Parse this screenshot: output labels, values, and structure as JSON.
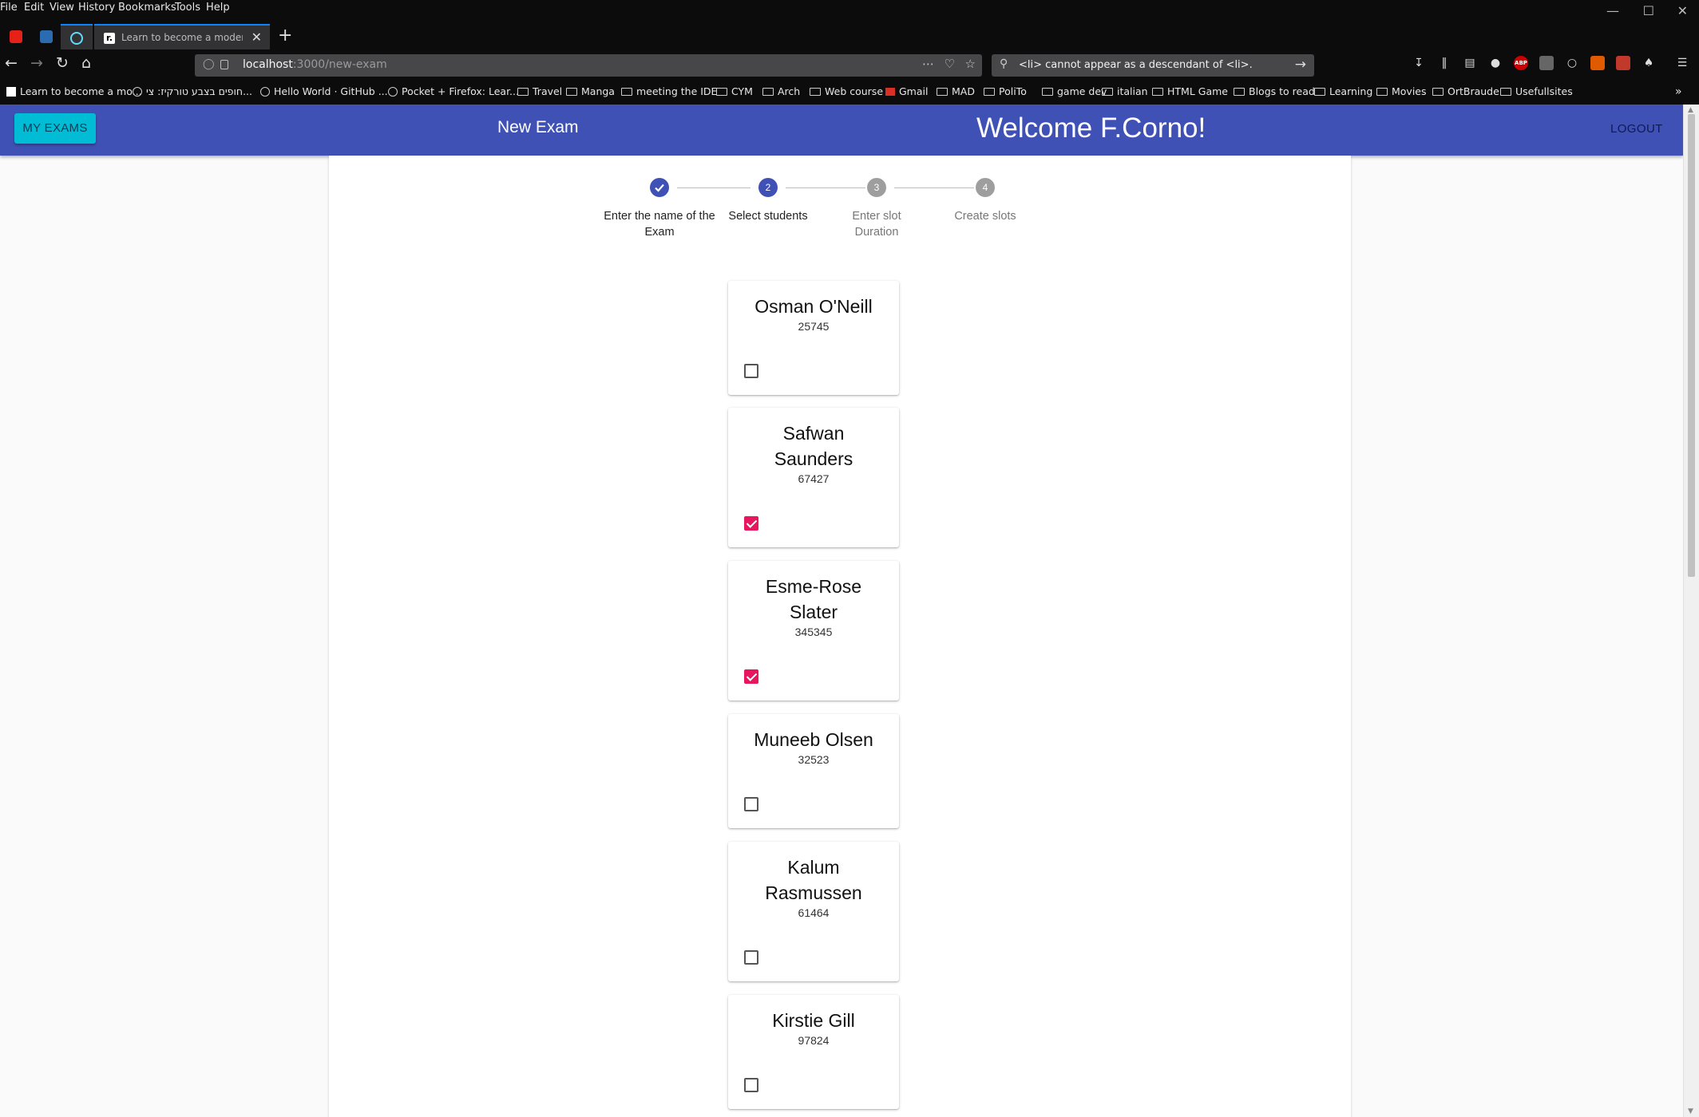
{
  "browser": {
    "menu": [
      "File",
      "Edit",
      "View",
      "History",
      "Bookmarks",
      "Tools",
      "Help"
    ],
    "tab_title": "Learn to become a modern fro",
    "url_host": "localhost",
    "url_path": ":3000/new-exam",
    "search_text": "<li> cannot appear as a descendant of <li>.",
    "bookmarks": [
      "Learn to become a mo...",
      "חופים בצבע טורקיז: צי...",
      "Hello World · GitHub ...",
      "Pocket + Firefox: Lear...",
      "Travel",
      "Manga",
      "meeting the IDE",
      "CYM",
      "Arch",
      "Web course",
      "Gmail",
      "MAD",
      "PoliTo",
      "game dev",
      "italian",
      "HTML Game",
      "Blogs to read",
      "Learning",
      "Movies",
      "OrtBraude",
      "Usefullsites"
    ],
    "toolbar_badge": "ABP"
  },
  "appbar": {
    "my_exams": "MY EXAMS",
    "title": "New Exam",
    "welcome": "Welcome F.Corno!",
    "logout": "LOGOUT",
    "color": "#3f51b5"
  },
  "stepper": {
    "active_step": 2,
    "steps": [
      {
        "number": "1",
        "label": "Enter the name of the Exam",
        "state": "completed"
      },
      {
        "number": "2",
        "label": "Select students",
        "state": "active"
      },
      {
        "number": "3",
        "label": "Enter slot Duration",
        "state": "pending"
      },
      {
        "number": "4",
        "label": "Create slots",
        "state": "pending"
      }
    ]
  },
  "students": [
    {
      "name": "Osman O'Neill",
      "id": "25745",
      "selected": false
    },
    {
      "name": "Safwan Saunders",
      "id": "67427",
      "selected": true
    },
    {
      "name": "Esme-Rose Slater",
      "id": "345345",
      "selected": true
    },
    {
      "name": "Muneeb Olsen",
      "id": "32523",
      "selected": false
    },
    {
      "name": "Kalum Rasmussen",
      "id": "61464",
      "selected": false
    },
    {
      "name": "Kirstie Gill",
      "id": "97824",
      "selected": false
    }
  ],
  "colors": {
    "checkbox_checked": "#e8155f",
    "step_active": "#3f51b5",
    "step_pending": "#9e9e9e",
    "accent_button": "#00bcd4"
  }
}
